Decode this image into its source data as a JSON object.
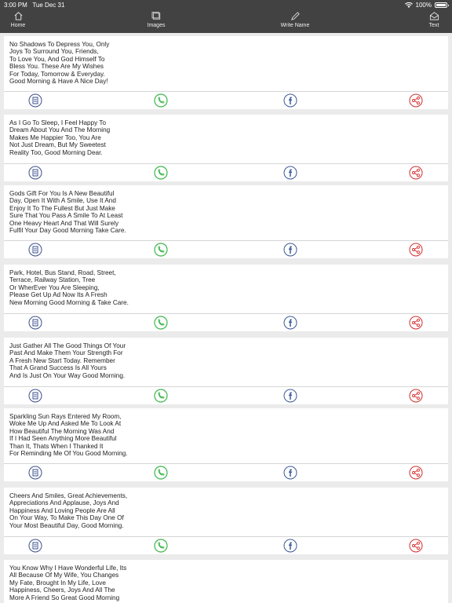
{
  "status": {
    "time": "3:00 PM",
    "date": "Tue Dec 31",
    "battery": "100%"
  },
  "nav": [
    {
      "label": "Home",
      "icon": "home-icon"
    },
    {
      "label": "Images",
      "icon": "images-icon"
    },
    {
      "label": "Write Name",
      "icon": "pen-icon"
    },
    {
      "label": "Text",
      "icon": "envelope-icon"
    }
  ],
  "quotes": [
    {
      "text": "No Shadows To Depress You, Only\nJoys To Surround You, Friends,\nTo Love You, And God Himself To\nBless You. These Are My Wishes\nFor Today, Tomorrow & Everyday.\nGood Morning & Have A Nice Day!"
    },
    {
      "text": "As I Go To Sleep, I Feel Happy To\nDream About You And The Morning\nMakes Me Happier Too, You Are\nNot Just Dream, But My Sweetest\nReality Too, Good Morning Dear."
    },
    {
      "text": "Gods Gift For You Is A New Beautiful\nDay, Open It With A Smile, Use It And\nEnjoy It To The Fullest But Just Make\nSure That You Pass A Smile To At Least\nOne Heavy Heart And That Will Surely\nFulfil Your Day Good Morning Take Care."
    },
    {
      "text": "Park, Hotel, Bus Stand, Road, Street,\nTerrace, Railway Station, Tree\nOr WherEver You Are Sleeping,\nPlease Get Up Ad Now Its A Fresh\nNew Morning Good Morning & Take Care."
    },
    {
      "text": "Just Gather All The Good Things Of Your\nPast And Make Them Your Strength For\nA Fresh New Start Today. Remember\nThat A Grand Success Is All Yours\nAnd Is Just On Your Way Good Morning."
    },
    {
      "text": "Sparkling Sun Rays Entered My Room,\nWoke Me Up And Asked Me To Look At\nHow Beautiful The Morning Was And\nIf I Had Seen Anything More Beautiful\nThan It, Thats When I Thanked It\nFor Reminding Me Of You Good Morning."
    },
    {
      "text": "Cheers And Smiles, Great Achievements,\nAppreciations And Applause, Joys And\nHappiness And Loving People Are All\nOn Your Way, To Make This Day One Of\nYour Most Beautiful Day, Good Morning."
    },
    {
      "text": "You Know Why I Have Wonderful Life, Its\nAll Because Of My Wife, You Changes\nMy Fate, Brought In My Life, Love\nHappiness, Cheers, Joys And All The\nMore A Friend So Great Good Morning"
    }
  ],
  "actions": [
    {
      "icon": "copy-icon",
      "color": "#3b4f8c"
    },
    {
      "icon": "whatsapp-icon",
      "color": "#3cb64a"
    },
    {
      "icon": "facebook-icon",
      "color": "#3b5998"
    },
    {
      "icon": "share-icon",
      "color": "#d32f2f"
    }
  ]
}
